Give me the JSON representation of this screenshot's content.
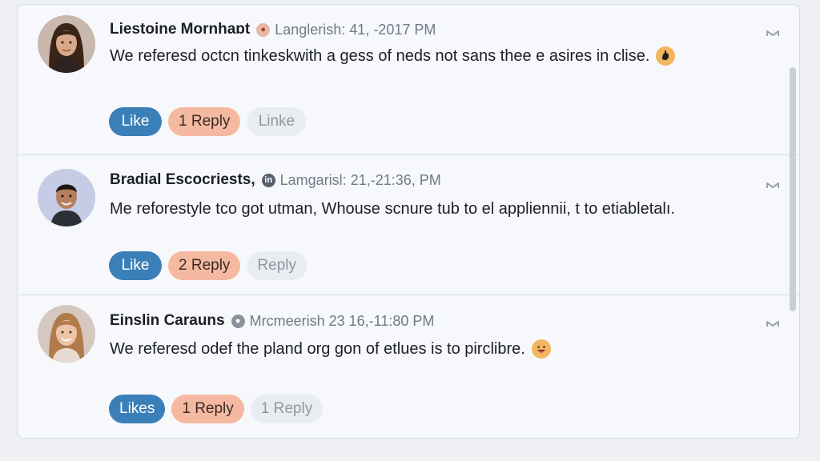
{
  "comments": [
    {
      "author": "Liestoine Mornhaɒt",
      "meta": "Langlerish: 41, -2017 PM",
      "meta_icon": "location-icon",
      "body": "We referesd octcn tinkeskwith a gess of neds not sans thee e asires in clise.",
      "emoji": "hand-emoji-icon",
      "actions": [
        "Like",
        "1 Reply",
        "Linke"
      ]
    },
    {
      "author": "Bradial Escocriests,",
      "meta": "Lamgarisl: 21,-21:36, PM",
      "meta_icon": "linkedin-icon",
      "body": "Me reforestyle tco got utman, Whouse scnure tub to el appliennii, t to etiabletalı.",
      "emoji": "",
      "actions": [
        "Like",
        "2 Reply",
        "Reply"
      ]
    },
    {
      "author": "Einslin Carauns",
      "meta": "Mrcmeerish 23 16,-11:80 PM",
      "meta_icon": "user-icon",
      "body": "We referesd odef the pland org gon of etlues is to pirclibre.",
      "emoji": "smile-emoji-icon",
      "actions": [
        "Likes",
        "1 Reply",
        "1 Reply"
      ]
    }
  ],
  "colors": {
    "like": "#3a7fb8",
    "reply": "#f5b9a2",
    "ghost": "#e9edf1",
    "emoji": "#f2b65e"
  }
}
